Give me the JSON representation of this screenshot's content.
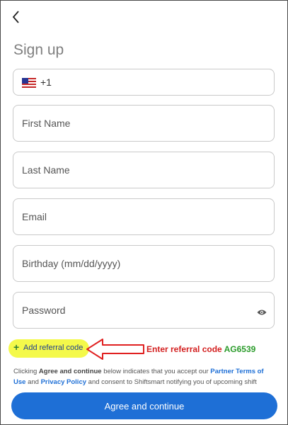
{
  "header": {
    "title": "Sign up"
  },
  "phone": {
    "country_code": "+1"
  },
  "fields": {
    "first_name": "First Name",
    "last_name": "Last Name",
    "email": "Email",
    "birthday": "Birthday (mm/dd/yyyy)",
    "password": "Password"
  },
  "referral": {
    "label": "Add referral code"
  },
  "annotation": {
    "prefix": "Enter referral code ",
    "code": "AG6539"
  },
  "legal": {
    "part1": "Clicking ",
    "agree_word": "Agree and continue",
    "part2": " below indicates that you accept our ",
    "partner_terms": "Partner Terms of Use",
    "and": " and ",
    "privacy": "Privacy Policy",
    "part3": " and consent to Shiftsmart notifying you of upcoming shift"
  },
  "buttons": {
    "agree": "Agree and continue"
  },
  "colors": {
    "primary": "#1e6fd6",
    "highlight": "#f4f94a",
    "annotation_red": "#d31f1f",
    "annotation_green": "#2a9b2a"
  }
}
